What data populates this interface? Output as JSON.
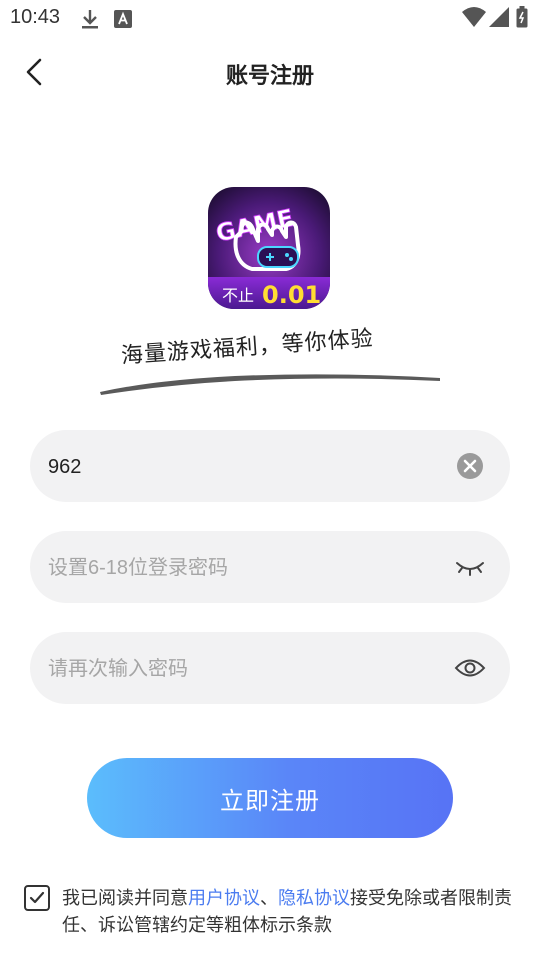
{
  "status_bar": {
    "time": "10:43",
    "left_icons": [
      "download-icon",
      "a-notification-icon"
    ],
    "right_icons": [
      "wifi-icon",
      "signal-icon",
      "battery-icon"
    ]
  },
  "header": {
    "title": "账号注册",
    "back_icon": "chevron-left-icon"
  },
  "logo": {
    "game_text": "GAME",
    "badge_prefix": "不止",
    "badge_value": "0.01"
  },
  "slogan": "海量游戏福利，等你体验",
  "form": {
    "account": {
      "value": "962",
      "clear_icon": "clear-icon"
    },
    "password": {
      "placeholder": "设置6-18位登录密码",
      "toggle_icon": "eye-closed-icon"
    },
    "confirm_password": {
      "placeholder": "请再次输入密码",
      "toggle_icon": "eye-icon"
    }
  },
  "register_button": "立即注册",
  "agreement": {
    "checked": true,
    "text_before": "我已阅读并同意",
    "user_agreement": "用户协议",
    "separator": "、",
    "privacy_policy": "隐私协议",
    "text_after": "接受免除或者限制责任、诉讼管辖约定等粗体标示条款"
  },
  "colors": {
    "accent_link": "#4b7cf0",
    "button_gradient_start": "#5bbdfc",
    "button_gradient_end": "#5773f5",
    "field_background": "#f2f2f3",
    "logo_badge": "#ffdd33"
  }
}
